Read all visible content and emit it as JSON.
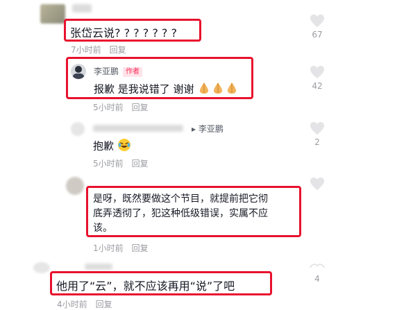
{
  "colors": {
    "highlight_box": "#e8112d",
    "meta_gray": "#9b9ca1",
    "author_tag": "#fe2c55"
  },
  "comments": [
    {
      "text": "张岱云说? ? ? ? ? ? ?",
      "time": "7小时前",
      "reply": "回复",
      "likes": "67"
    },
    {
      "username": "李亚鹏",
      "tag": "作者",
      "text": "报歉 是我说错了 谢谢",
      "emoji_icons": [
        "pray-hands-icon",
        "pray-hands-icon",
        "pray-hands-icon"
      ],
      "time": "5小时前",
      "reply": "回复",
      "likes": "42"
    },
    {
      "reply_to": "▸ 李亚鹏",
      "text": "抱歉",
      "emoji_icon": "laughing-tears-icon",
      "time": "5小时前",
      "reply": "回复",
      "likes": "2"
    },
    {
      "text_line1": "是呀，既然要做这个节目，就提前把它彻",
      "text_line2": "底弄透彻了，犯这种低级错误，实属不应",
      "text_line3": "该。",
      "time": "1小时前",
      "reply": "回复"
    },
    {
      "text": "他用了“云”，就不应该再用“说”了吧",
      "time": "4小时前",
      "reply": "回复",
      "likes": "4"
    }
  ]
}
